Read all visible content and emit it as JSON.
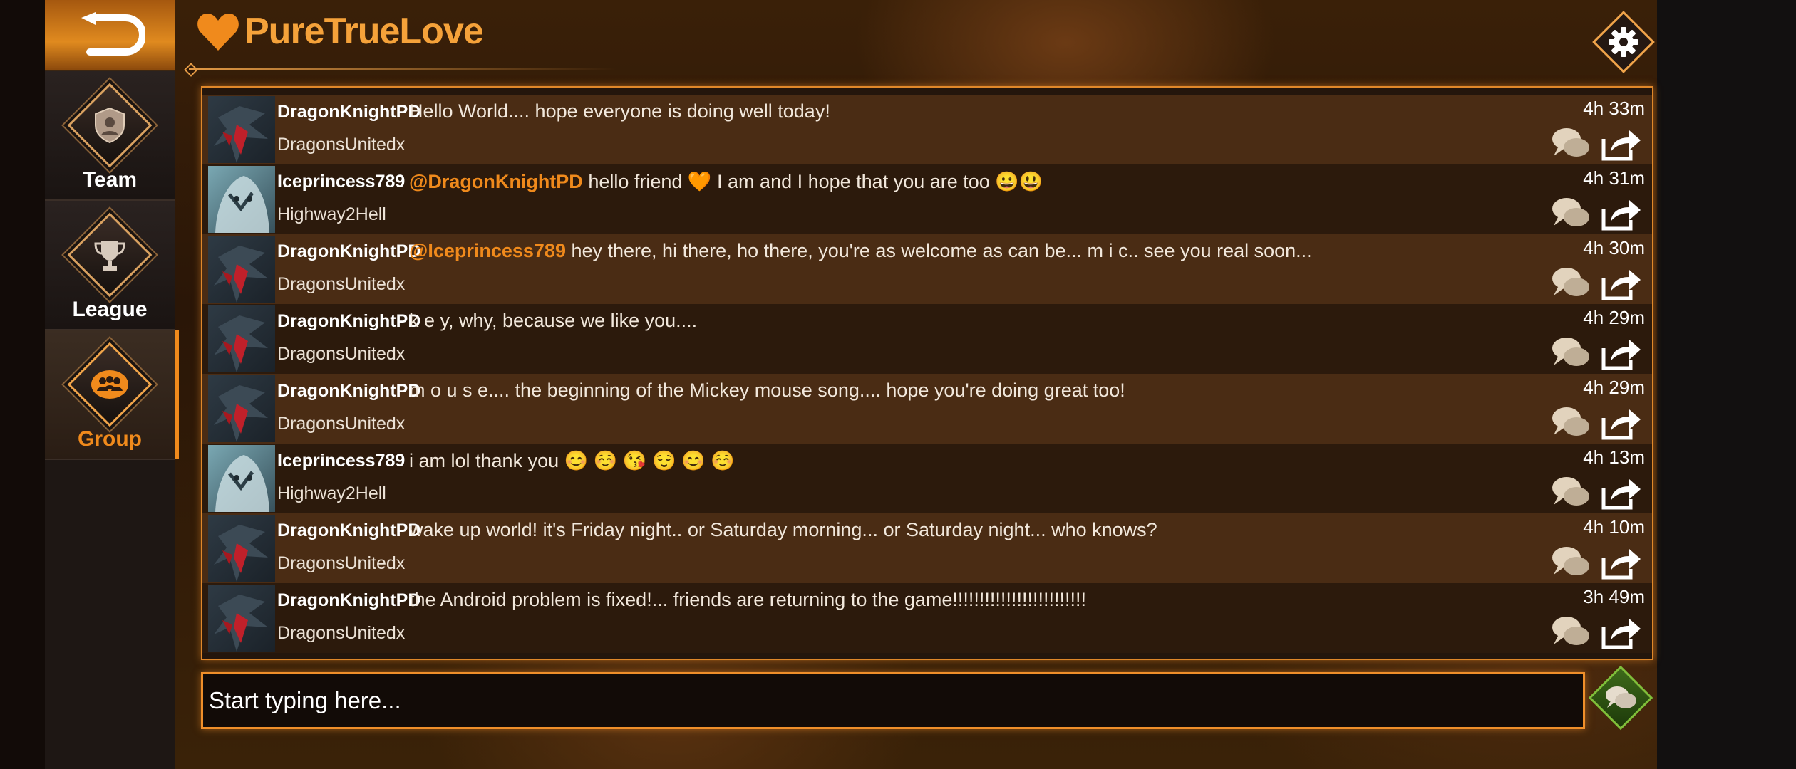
{
  "app": {
    "name": "PureTrueLove",
    "accent_color": "#f08a1c"
  },
  "nav": {
    "items": [
      {
        "label": "Team",
        "icon": "team-shield-icon",
        "active": false
      },
      {
        "label": "League",
        "icon": "trophy-icon",
        "active": false
      },
      {
        "label": "Group",
        "icon": "group-people-icon",
        "active": true
      }
    ]
  },
  "messages": [
    {
      "user": "DragonKnightPD",
      "guild": "DragonsUnitedx",
      "mention": "",
      "text": "Hello World.... hope everyone is doing well today!",
      "time": "4h 33m",
      "avatar": "dragon"
    },
    {
      "user": "Iceprincess789",
      "guild": "Highway2Hell",
      "mention": "@DragonKnightPD",
      "text": "hello friend 🧡 I am and I hope that you are too  😀😃",
      "time": "4h 31m",
      "avatar": "ice"
    },
    {
      "user": "DragonKnightPD",
      "guild": "DragonsUnitedx",
      "mention": "@Iceprincess789",
      "text": "hey there, hi there, ho there, you're as welcome as can be... m i c.. see you real soon...",
      "time": "4h 30m",
      "avatar": "dragon"
    },
    {
      "user": "DragonKnightPD",
      "guild": "DragonsUnitedx",
      "mention": "",
      "text": "k e y, why, because we like you....",
      "time": "4h 29m",
      "avatar": "dragon"
    },
    {
      "user": "DragonKnightPD",
      "guild": "DragonsUnitedx",
      "mention": "",
      "text": "m o u s e.... the beginning of the Mickey mouse song.... hope you're doing great too!",
      "time": "4h 29m",
      "avatar": "dragon"
    },
    {
      "user": "Iceprincess789",
      "guild": "Highway2Hell",
      "mention": "",
      "text": "i am lol thank you 😊 ☺️ 😘 😌 😊 ☺️",
      "time": "4h 13m",
      "avatar": "ice"
    },
    {
      "user": "DragonKnightPD",
      "guild": "DragonsUnitedx",
      "mention": "",
      "text": "wake up world! it's Friday night.. or Saturday morning... or Saturday night... who knows?",
      "time": "4h 10m",
      "avatar": "dragon"
    },
    {
      "user": "DragonKnightPD",
      "guild": "DragonsUnitedx",
      "mention": "",
      "text": "the Android problem is fixed!... friends are returning to the game!!!!!!!!!!!!!!!!!!!!!!!!!",
      "time": "3h 49m",
      "avatar": "dragon"
    }
  ],
  "composer": {
    "placeholder": "Start typing here..."
  }
}
